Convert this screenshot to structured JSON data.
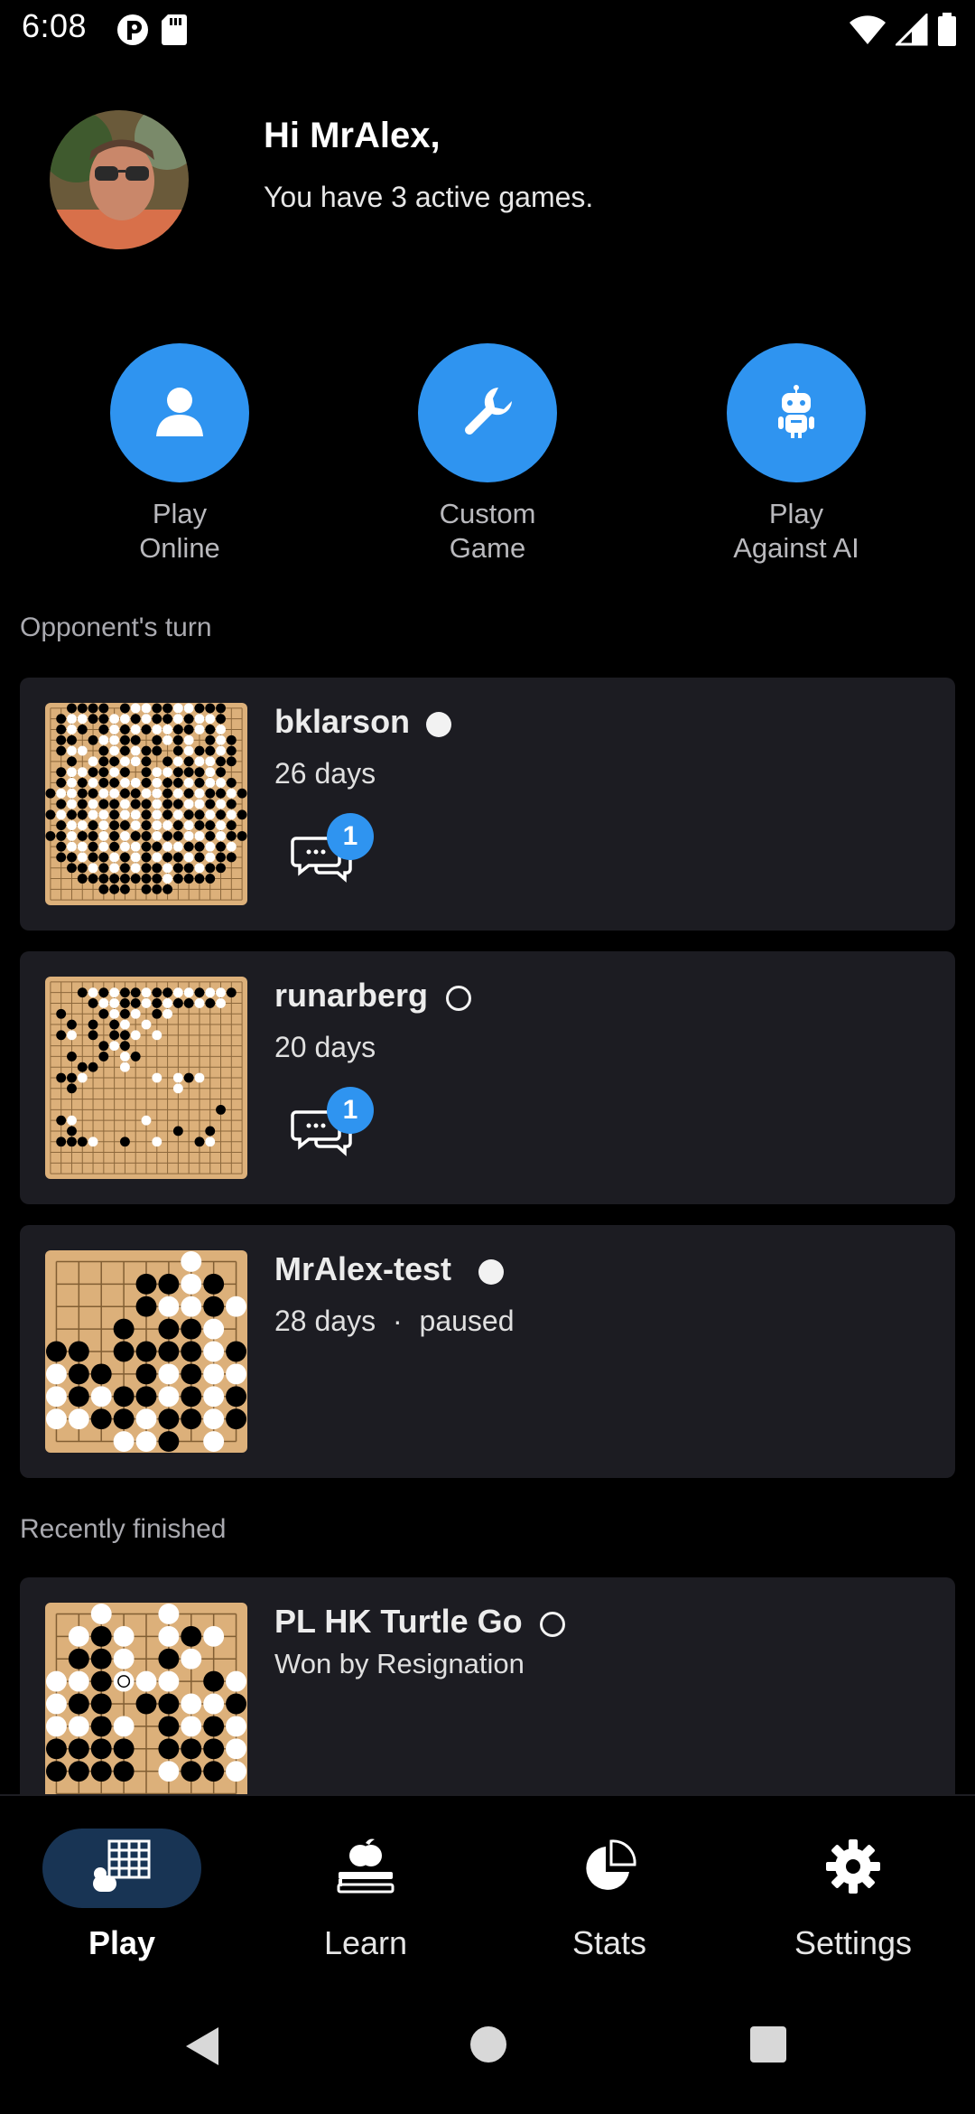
{
  "status_bar": {
    "time": "6:08"
  },
  "header": {
    "greeting": "Hi MrAlex,",
    "subtitle": "You have 3 active games."
  },
  "quick_actions": [
    {
      "label": "Play\nOnline",
      "icon": "person-icon"
    },
    {
      "label": "Custom\nGame",
      "icon": "wrench-icon"
    },
    {
      "label": "Play\nAgainst AI",
      "icon": "robot-icon"
    }
  ],
  "sections": {
    "opponents_turn": "Opponent's turn",
    "recently_finished": "Recently finished"
  },
  "games": [
    {
      "opponent": "bklarson",
      "turn_stone": "white",
      "time_left": "26 days",
      "unread_messages": "1"
    },
    {
      "opponent": "runarberg",
      "turn_stone": "black",
      "time_left": "20 days",
      "unread_messages": "1"
    },
    {
      "opponent": "MrAlex-test",
      "turn_stone": "white",
      "time_left": "28 days",
      "separator": "·",
      "status": "paused"
    }
  ],
  "finished_games": [
    {
      "opponent": "PL HK Turtle Go",
      "turn_stone": "black",
      "result": "Won by Resignation"
    }
  ],
  "bottom_nav": [
    {
      "label": "Play",
      "icon": "board-icon",
      "active": true
    },
    {
      "label": "Learn",
      "icon": "apple-book-icon"
    },
    {
      "label": "Stats",
      "icon": "pie-chart-icon"
    },
    {
      "label": "Settings",
      "icon": "gear-icon"
    }
  ],
  "colors": {
    "accent": "#2f94f0",
    "card": "#1c1c22",
    "board": "#dcb07a",
    "nav_active": "#183454"
  }
}
